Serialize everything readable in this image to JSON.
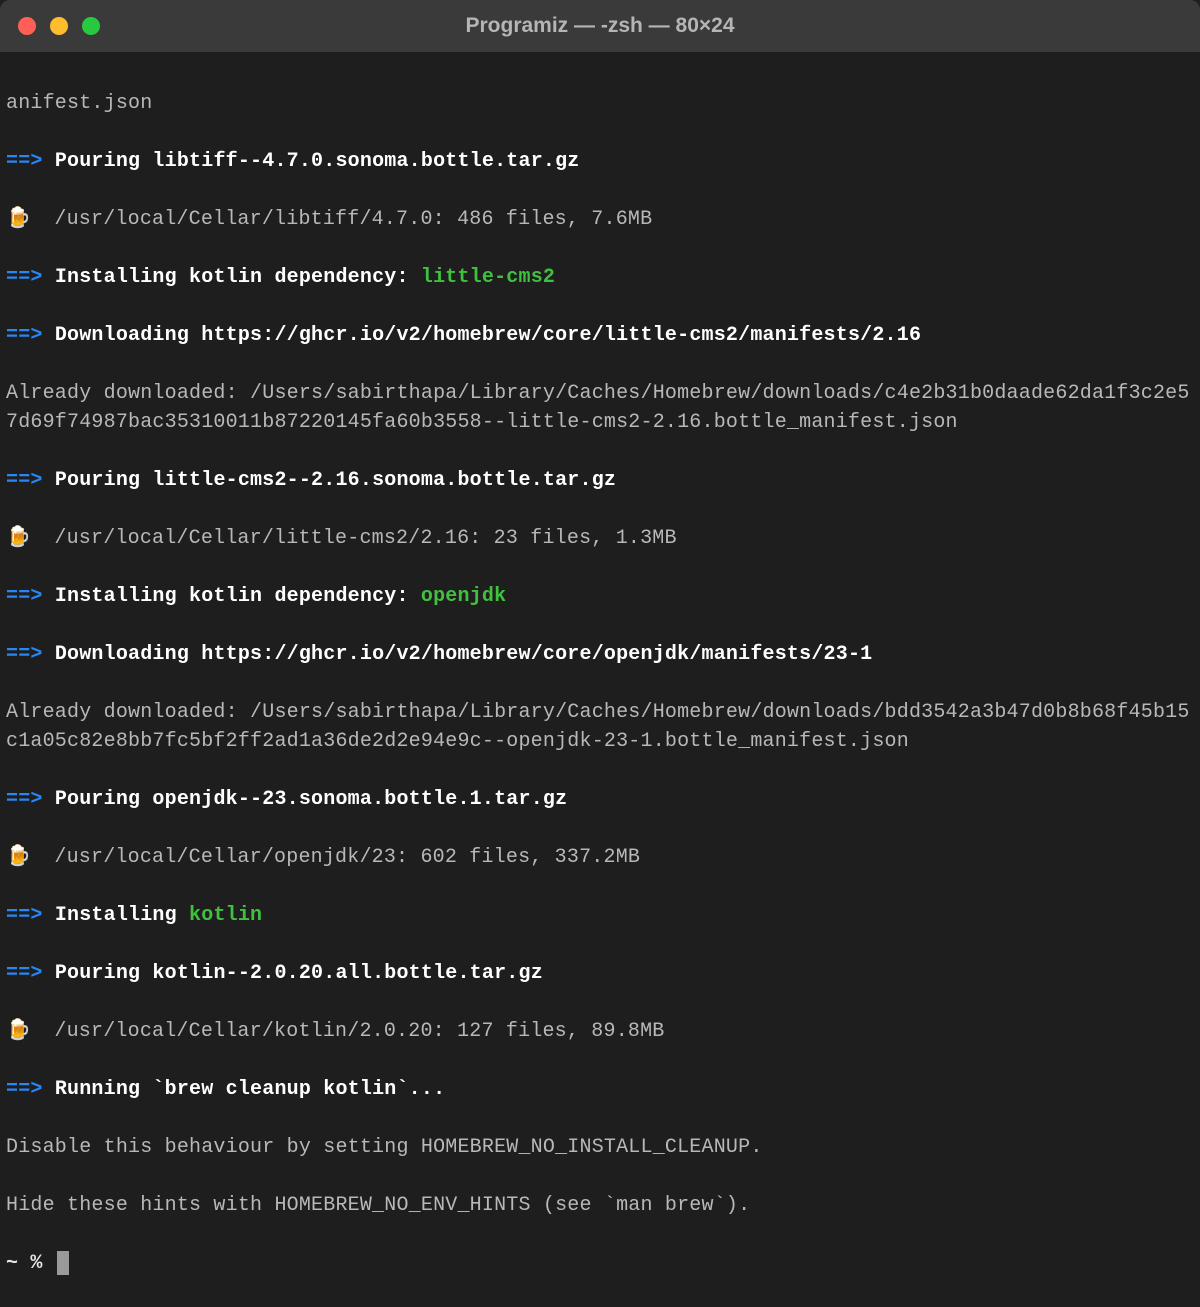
{
  "titlebar": {
    "title": "Programiz — -zsh — 80×24"
  },
  "lines": {
    "l0": "anifest.json",
    "l1a": "==>",
    "l1b": "Pouring libtiff--4.7.0.sonoma.bottle.tar.gz",
    "l2a": "🍺",
    "l2b": "  /usr/local/Cellar/libtiff/4.7.0: 486 files, 7.6MB",
    "l3a": "==>",
    "l3b": "Installing kotlin dependency: ",
    "l3c": "little-cms2",
    "l4a": "==>",
    "l4b": "Downloading https://ghcr.io/v2/homebrew/core/little-cms2/manifests/2.16",
    "l5": "Already downloaded: /Users/sabirthapa/Library/Caches/Homebrew/downloads/c4e2b31b0daade62da1f3c2e57d69f74987bac35310011b87220145fa60b3558--little-cms2-2.16.bottle_manifest.json",
    "l6a": "==>",
    "l6b": "Pouring little-cms2--2.16.sonoma.bottle.tar.gz",
    "l7a": "🍺",
    "l7b": "  /usr/local/Cellar/little-cms2/2.16: 23 files, 1.3MB",
    "l8a": "==>",
    "l8b": "Installing kotlin dependency: ",
    "l8c": "openjdk",
    "l9a": "==>",
    "l9b": "Downloading https://ghcr.io/v2/homebrew/core/openjdk/manifests/23-1",
    "l10": "Already downloaded: /Users/sabirthapa/Library/Caches/Homebrew/downloads/bdd3542a3b47d0b8b68f45b15c1a05c82e8bb7fc5bf2ff2ad1a36de2d2e94e9c--openjdk-23-1.bottle_manifest.json",
    "l11a": "==>",
    "l11b": "Pouring openjdk--23.sonoma.bottle.1.tar.gz",
    "l12a": "🍺",
    "l12b": "  /usr/local/Cellar/openjdk/23: 602 files, 337.2MB",
    "l13a": "==>",
    "l13b": "Installing ",
    "l13c": "kotlin",
    "l14a": "==>",
    "l14b": "Pouring kotlin--2.0.20.all.bottle.tar.gz",
    "l15a": "🍺",
    "l15b": "  /usr/local/Cellar/kotlin/2.0.20: 127 files, 89.8MB",
    "l16a": "==>",
    "l16b": "Running `brew cleanup kotlin`...",
    "l17": "Disable this behaviour by setting HOMEBREW_NO_INSTALL_CLEANUP.",
    "l18": "Hide these hints with HOMEBREW_NO_ENV_HINTS (see `man brew`).",
    "prompt": "~ % "
  }
}
